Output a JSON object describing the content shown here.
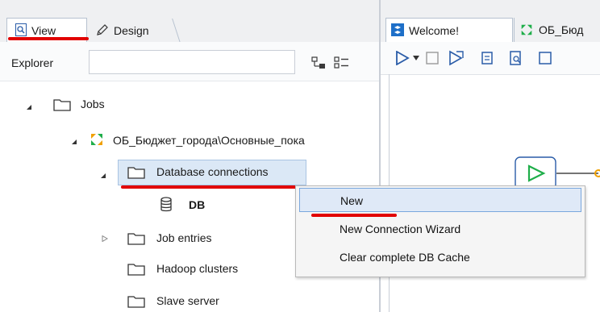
{
  "left_tabs": [
    {
      "label": "View",
      "icon": "search-page-icon",
      "active": true
    },
    {
      "label": "Design",
      "icon": "pencil-icon",
      "active": false
    }
  ],
  "explorer": {
    "label": "Explorer",
    "search_value": ""
  },
  "tree": {
    "jobs": "Jobs",
    "job_name": "ОБ_Бюджет_города\\Основные_пока",
    "database_connections": "Database connections",
    "db": "DB",
    "job_entries": "Job entries",
    "hadoop_clusters": "Hadoop clusters",
    "slave_server": "Slave server"
  },
  "right_tabs": [
    {
      "label": "Welcome!",
      "icon": "welcome-icon"
    },
    {
      "label": "ОБ_Бюд",
      "icon": "job-icon"
    }
  ],
  "context_menu": {
    "items": [
      "New",
      "New Connection Wizard",
      "Clear complete DB Cache"
    ]
  },
  "colors": {
    "accent_red": "#e10000",
    "selection_blue": "#dbe8f6",
    "start_node_green": "#1fae4a",
    "job_orange": "#f0a000"
  }
}
